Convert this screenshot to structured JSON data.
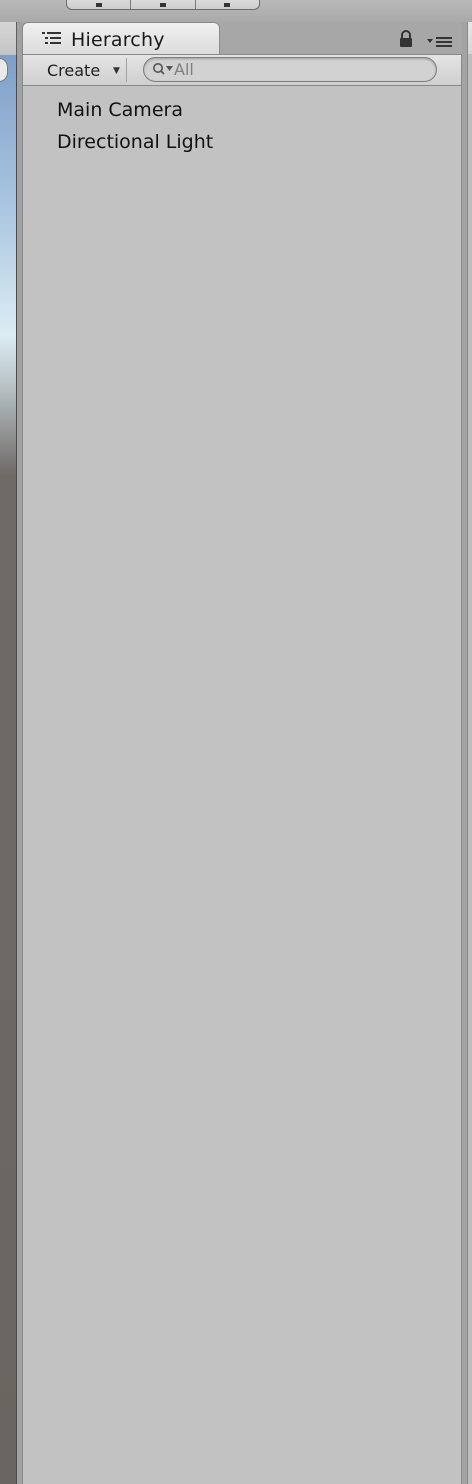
{
  "hierarchy": {
    "tab_label": "Hierarchy",
    "create_label": "Create",
    "create_arrow": "▼",
    "search": {
      "placeholder": "All",
      "value": ""
    },
    "items": [
      {
        "label": "Main Camera"
      },
      {
        "label": "Directional Light"
      }
    ]
  },
  "scene_view": {
    "menu_icon": "≡"
  }
}
